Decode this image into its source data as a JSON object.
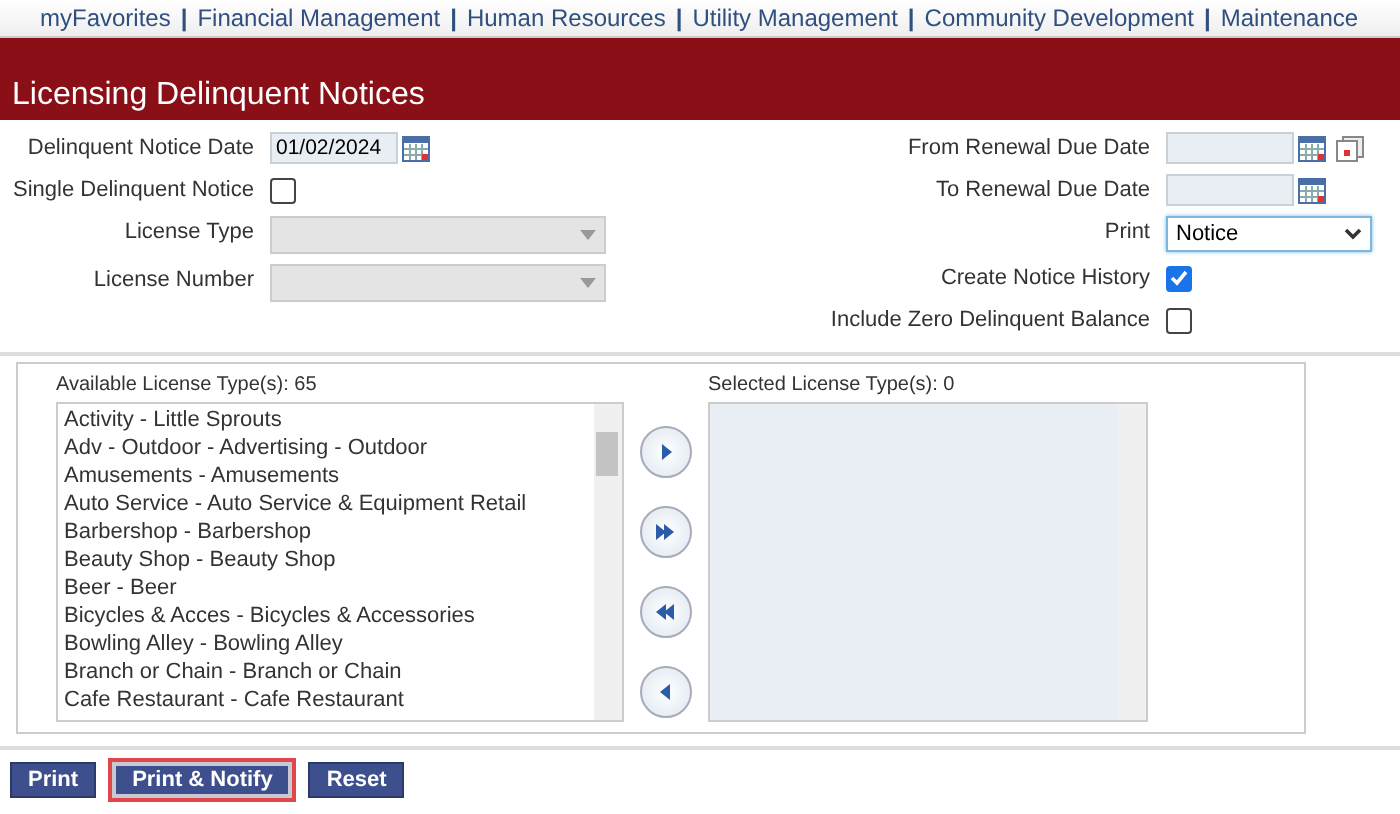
{
  "nav": [
    {
      "kind": "link",
      "label": "myFavorites"
    },
    {
      "kind": "separator",
      "label": "|"
    },
    {
      "kind": "link",
      "label": "Financial Management"
    },
    {
      "kind": "separator",
      "label": "|"
    },
    {
      "kind": "link",
      "label": "Human Resources"
    },
    {
      "kind": "separator",
      "label": "|"
    },
    {
      "kind": "link",
      "label": "Utility Management"
    },
    {
      "kind": "separator",
      "label": "|"
    },
    {
      "kind": "link",
      "label": "Community Development"
    },
    {
      "kind": "separator",
      "label": "|"
    },
    {
      "kind": "link",
      "label": "Maintenance"
    }
  ],
  "title": "Licensing Delinquent Notices",
  "left_fields": [
    {
      "kind": "date",
      "label": "Delinquent Notice Date",
      "value": "01/02/2024"
    },
    {
      "kind": "checkbox",
      "label": "Single Delinquent Notice",
      "checked": false
    },
    {
      "kind": "select",
      "label": "License Type",
      "disabled": true
    },
    {
      "kind": "select",
      "label": "License Number",
      "disabled": true
    }
  ],
  "right_fields": [
    {
      "kind": "date",
      "label": "From Renewal Due Date",
      "extra_icon": true
    },
    {
      "kind": "date",
      "label": "To Renewal Due Date"
    },
    {
      "kind": "dropdown",
      "label": "Print",
      "value": "Notice"
    },
    {
      "kind": "checkbox",
      "label": "Create Notice History",
      "checked": true
    },
    {
      "kind": "checkbox",
      "label": "Include Zero Delinquent Balance",
      "checked": false
    }
  ],
  "available": {
    "label": "Available License Type(s): 65",
    "items": [
      "Activity - Little Sprouts",
      "Adv - Outdoor - Advertising - Outdoor",
      "Amusements - Amusements",
      "Auto Service - Auto Service & Equipment Retail",
      "Barbershop - Barbershop",
      "Beauty Shop - Beauty Shop",
      "Beer - Beer",
      "Bicycles & Acces - Bicycles & Accessories",
      "Bowling Alley - Bowling Alley",
      "Branch or Chain - Branch or Chain",
      "Cafe Restaurant - Cafe Restaurant"
    ]
  },
  "move_buttons": [
    {
      "kind": "right"
    },
    {
      "kind": "all-right"
    },
    {
      "kind": "all-left"
    },
    {
      "kind": "left"
    }
  ],
  "selected": {
    "label": "Selected License Type(s): 0"
  },
  "buttons": [
    {
      "label": "Print",
      "highlighted": false
    },
    {
      "label": "Print & Notify",
      "highlighted": true
    },
    {
      "label": "Reset",
      "highlighted": false
    }
  ]
}
